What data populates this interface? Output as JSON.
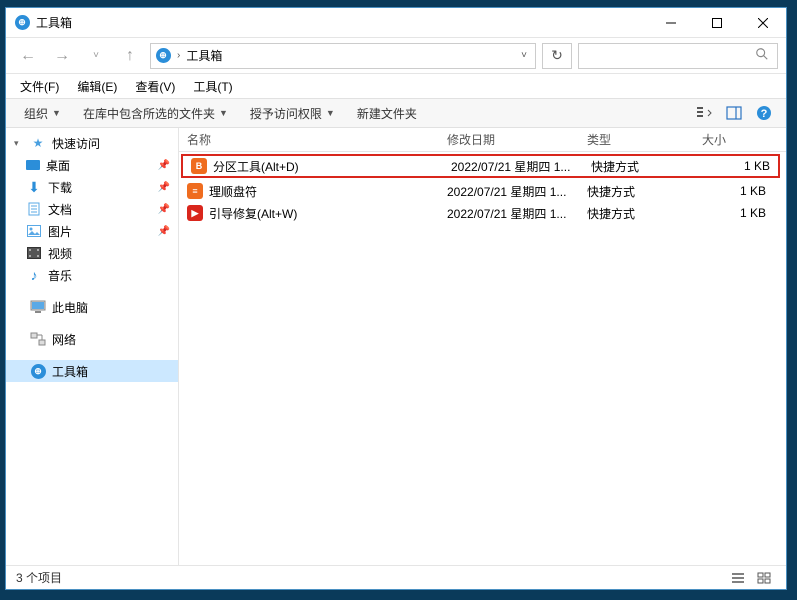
{
  "window": {
    "title": "工具箱"
  },
  "address": {
    "crumb": "工具箱"
  },
  "menubar": {
    "file": "文件(F)",
    "edit": "编辑(E)",
    "view": "查看(V)",
    "tools": "工具(T)"
  },
  "toolbar": {
    "organize": "组织",
    "include": "在库中包含所选的文件夹",
    "share": "授予访问权限",
    "newfolder": "新建文件夹"
  },
  "columns": {
    "name": "名称",
    "date": "修改日期",
    "type": "类型",
    "size": "大小"
  },
  "sidebar": {
    "quick_access": "快速访问",
    "desktop": "桌面",
    "downloads": "下载",
    "documents": "文档",
    "pictures": "图片",
    "videos": "视频",
    "music": "音乐",
    "this_pc": "此电脑",
    "network": "网络",
    "toolbox": "工具箱"
  },
  "files": [
    {
      "name": "分区工具(Alt+D)",
      "date": "2022/07/21 星期四 1...",
      "type": "快捷方式",
      "size": "1 KB",
      "icon_color": "#ef6c1f",
      "icon_letter": "B"
    },
    {
      "name": "理顺盘符",
      "date": "2022/07/21 星期四 1...",
      "type": "快捷方式",
      "size": "1 KB",
      "icon_color": "#ef6c1f",
      "icon_letter": "≡"
    },
    {
      "name": "引导修复(Alt+W)",
      "date": "2022/07/21 星期四 1...",
      "type": "快捷方式",
      "size": "1 KB",
      "icon_color": "#d9261c",
      "icon_letter": "▶"
    }
  ],
  "statusbar": {
    "count": "3 个项目"
  }
}
